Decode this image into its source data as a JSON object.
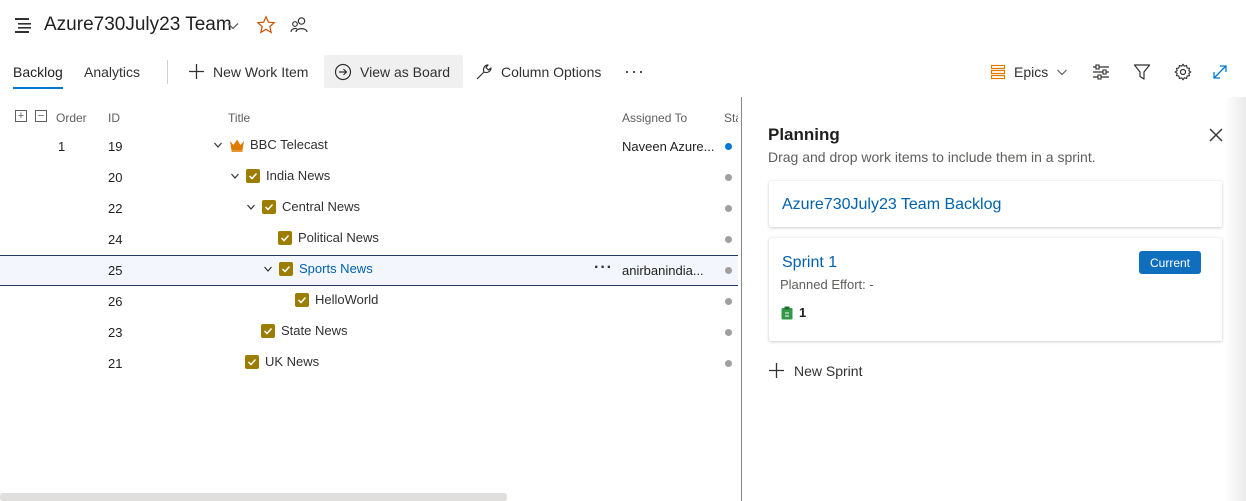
{
  "header": {
    "team_name": "Azure730July23 Team"
  },
  "toolbar": {
    "tabs": [
      {
        "label": "Backlog"
      },
      {
        "label": "Analytics"
      }
    ],
    "new_work_item": "New Work Item",
    "view_as_board": "View as Board",
    "column_options": "Column Options",
    "more": "···",
    "epics": "Epics"
  },
  "grid": {
    "columns": {
      "order": "Order",
      "id": "ID",
      "title": "Title",
      "assigned": "Assigned To",
      "state": "Sta"
    },
    "rows": [
      {
        "order": "1",
        "id": "19",
        "title": "BBC Telecast",
        "assigned": "Naveen Azure...",
        "state_color": "#0078d4"
      },
      {
        "order": "",
        "id": "20",
        "title": "India News",
        "assigned": "",
        "state_color": "#a19f9d"
      },
      {
        "order": "",
        "id": "22",
        "title": "Central News",
        "assigned": "",
        "state_color": "#a19f9d"
      },
      {
        "order": "",
        "id": "24",
        "title": "Political News",
        "assigned": "",
        "state_color": "#a19f9d"
      },
      {
        "order": "",
        "id": "25",
        "title": "Sports News",
        "assigned": "anirbanindia...",
        "state_color": "#a19f9d"
      },
      {
        "order": "",
        "id": "26",
        "title": "HelloWorld",
        "assigned": "",
        "state_color": "#a19f9d"
      },
      {
        "order": "",
        "id": "23",
        "title": "State News",
        "assigned": "",
        "state_color": "#a19f9d"
      },
      {
        "order": "",
        "id": "21",
        "title": "UK News",
        "assigned": "",
        "state_color": "#a19f9d"
      }
    ]
  },
  "planning": {
    "title": "Planning",
    "subtitle": "Drag and drop work items to include them in a sprint.",
    "backlog_link": "Azure730July23 Team Backlog",
    "sprint": {
      "name": "Sprint 1",
      "badge": "Current",
      "effort": "Planned Effort: -",
      "count": "1"
    },
    "new_sprint": "New Sprint"
  },
  "colors": {
    "accent": "#0078d4",
    "link": "#0062ad",
    "epic": "#e07b00",
    "task": "#9c7d00"
  }
}
